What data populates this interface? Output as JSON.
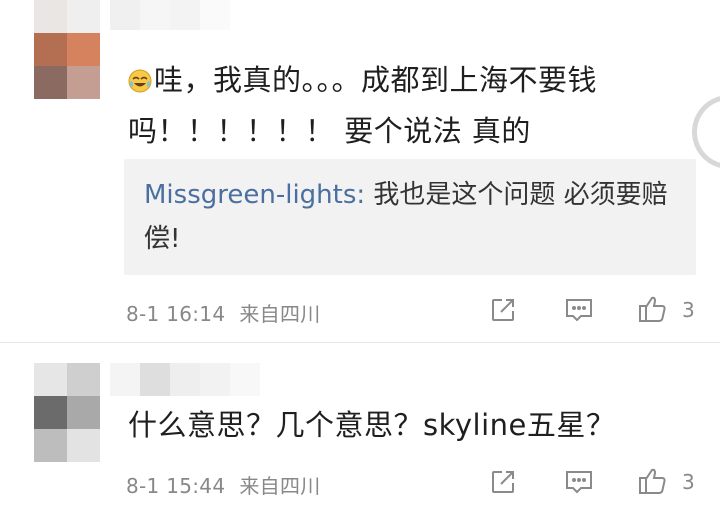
{
  "comments": [
    {
      "emoji": "crying-laughing-emoji",
      "text_line1": "哇，我真的。。。成都到上海不要钱",
      "text_line2": "吗！！！！！！ 要个说法 真的",
      "reply": {
        "author": "Missgreen-lights:",
        "text": " 我也是这个问题 必须要赔偿!"
      },
      "date": "8-1 16:14",
      "location": "来自四川",
      "like_count": "3"
    },
    {
      "text": "什么意思？几个意思？skyline五星？",
      "date": "8-1 15:44",
      "location": "来自四川",
      "like_count": "3"
    }
  ],
  "icons": {
    "share": "share-icon",
    "reply": "comment-icon",
    "like": "thumbs-up-icon"
  },
  "colors": {
    "reply_author": "#4a6fa0",
    "meta": "#888888",
    "quote_bg": "#f2f2f2"
  }
}
